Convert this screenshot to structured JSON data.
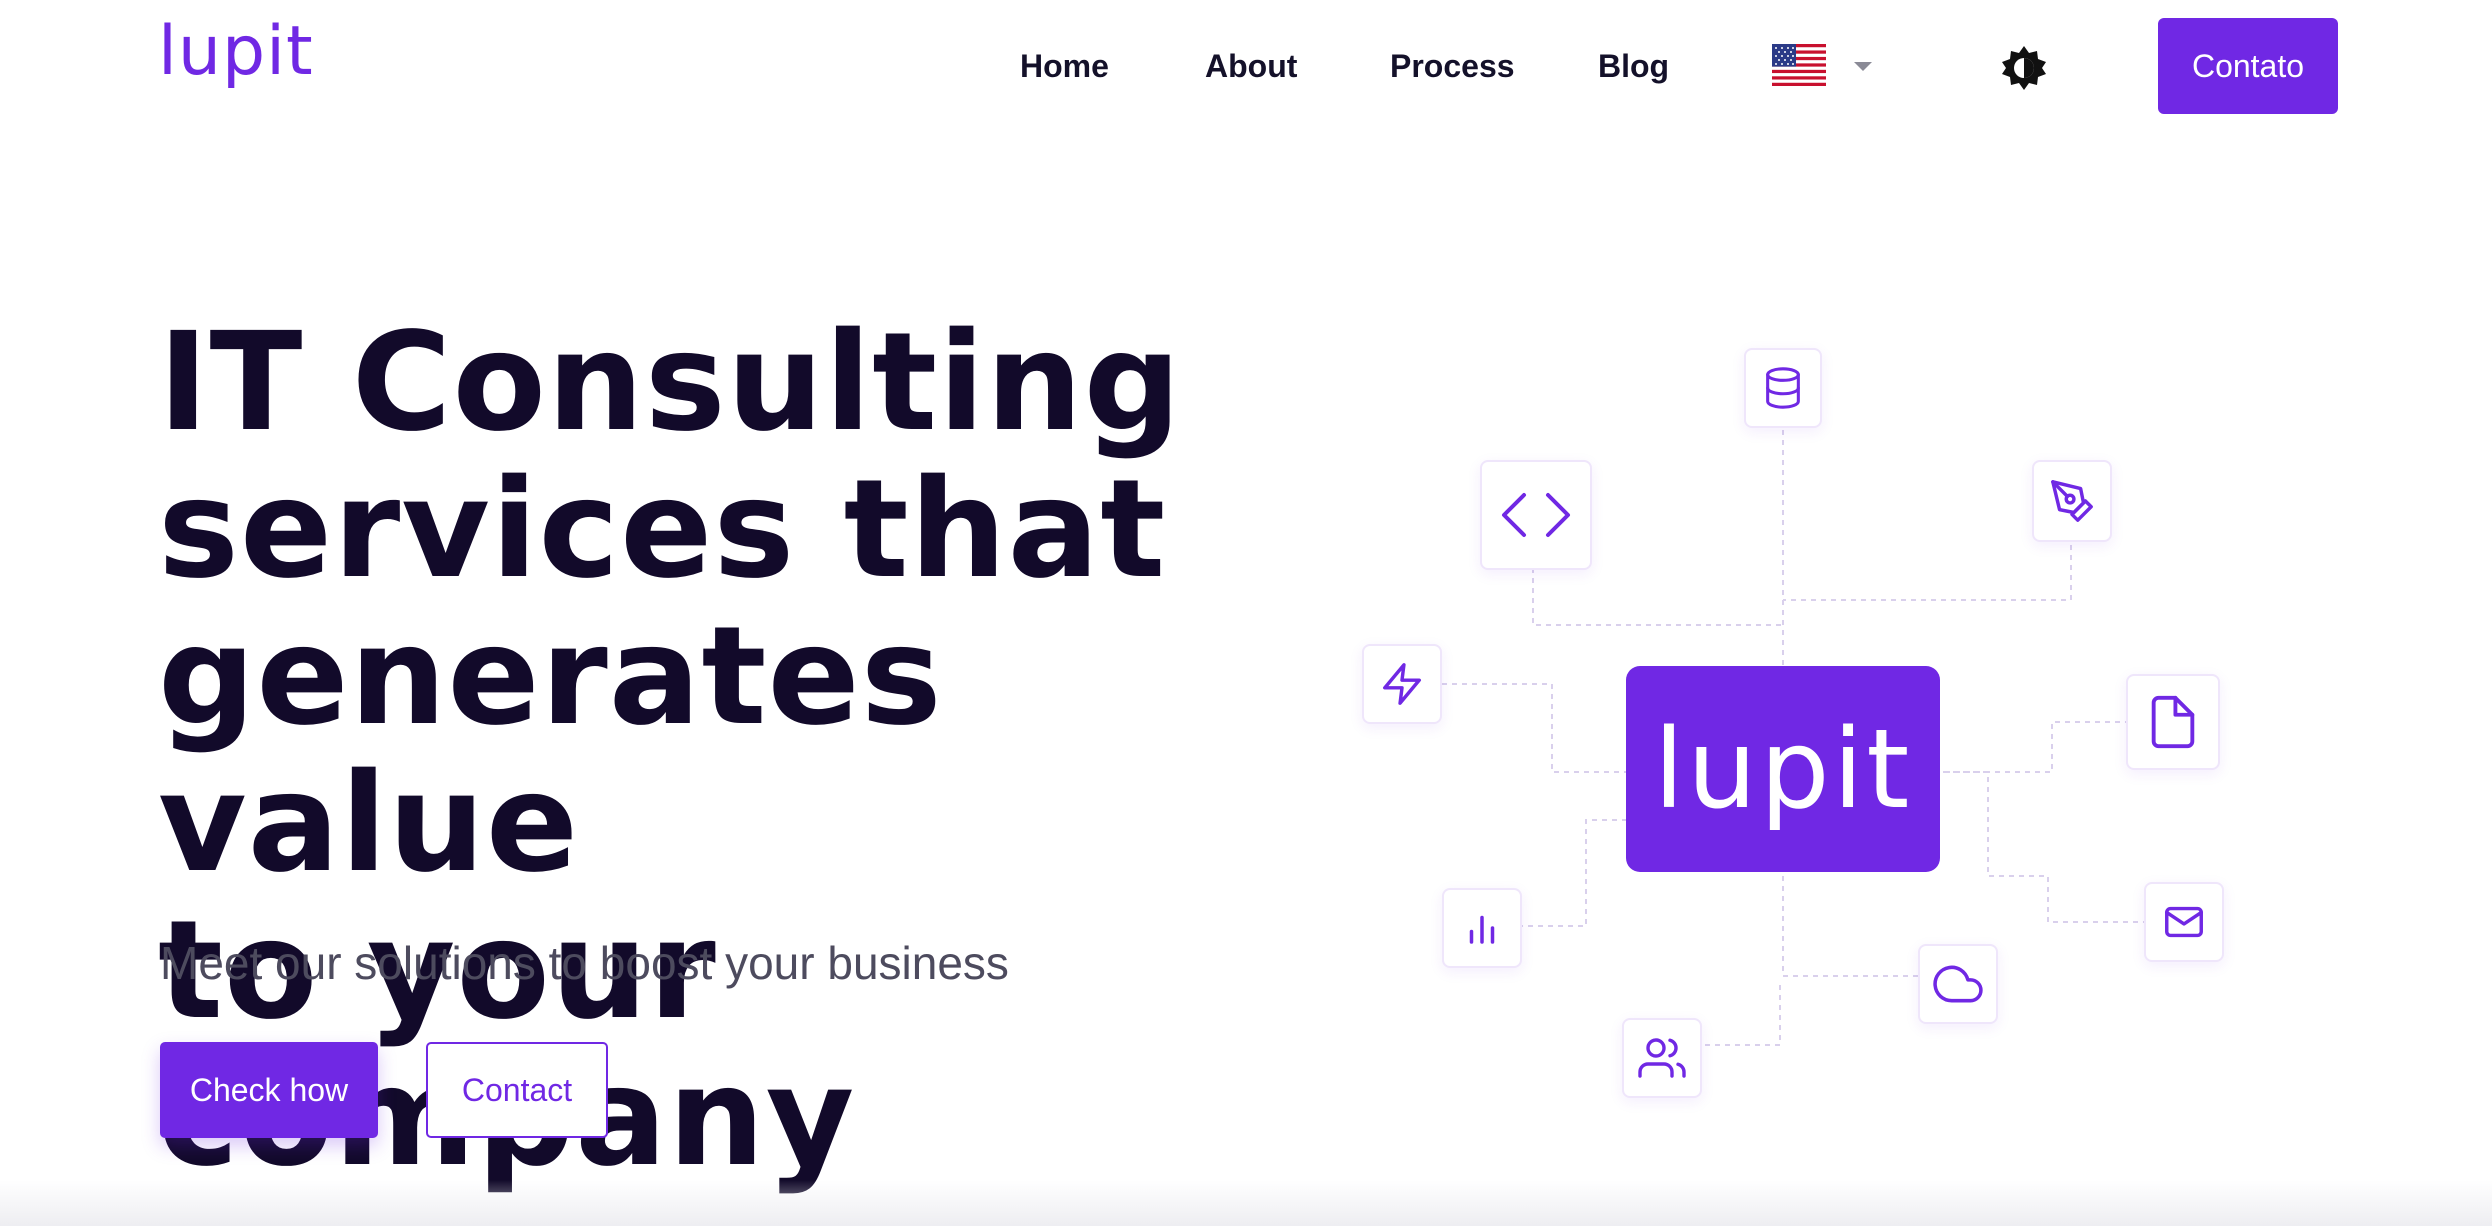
{
  "brand": {
    "logo_text": "lupit",
    "accent": "#7028e4",
    "heading_color": "#120a2a"
  },
  "nav": {
    "links": [
      "Home",
      "About",
      "Process",
      "Blog"
    ],
    "language_flag": "us-flag-icon",
    "theme_icon": "theme-toggle-icon",
    "contact_label": "Contato"
  },
  "hero": {
    "title_lines": [
      "IT Consulting",
      "services that",
      "generates value",
      "to your company"
    ],
    "subtitle": "Meet our solutions to boost your business",
    "primary_cta": "Check how",
    "secondary_cta": "Contact"
  },
  "illustration": {
    "hub_label": "lupit",
    "node_icons": [
      "database-icon",
      "code-icon",
      "pen-tool-icon",
      "lightning-icon",
      "file-icon",
      "bar-chart-icon",
      "mail-icon",
      "cloud-icon",
      "users-icon"
    ]
  }
}
